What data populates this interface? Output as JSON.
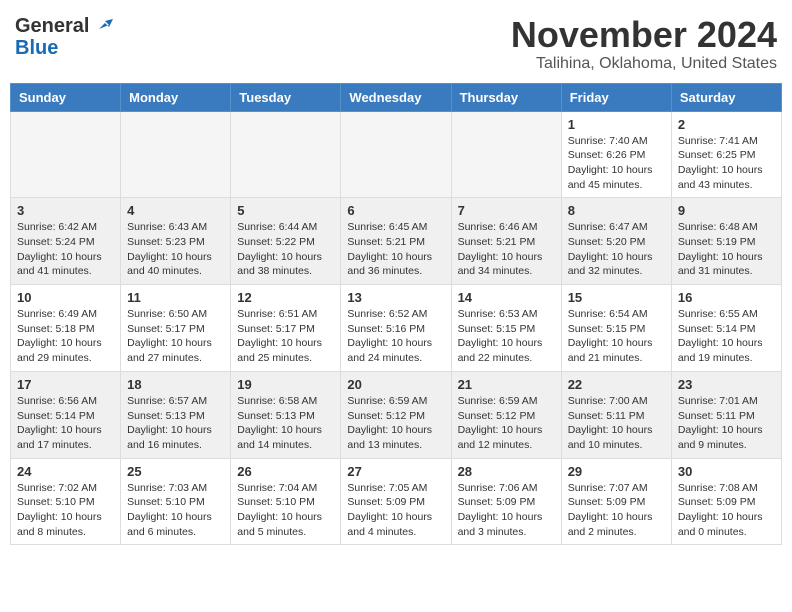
{
  "header": {
    "logo_general": "General",
    "logo_blue": "Blue",
    "month": "November 2024",
    "location": "Talihina, Oklahoma, United States"
  },
  "weekdays": [
    "Sunday",
    "Monday",
    "Tuesday",
    "Wednesday",
    "Thursday",
    "Friday",
    "Saturday"
  ],
  "weeks": [
    [
      {
        "day": "",
        "info": ""
      },
      {
        "day": "",
        "info": ""
      },
      {
        "day": "",
        "info": ""
      },
      {
        "day": "",
        "info": ""
      },
      {
        "day": "",
        "info": ""
      },
      {
        "day": "1",
        "info": "Sunrise: 7:40 AM\nSunset: 6:26 PM\nDaylight: 10 hours and 45 minutes."
      },
      {
        "day": "2",
        "info": "Sunrise: 7:41 AM\nSunset: 6:25 PM\nDaylight: 10 hours and 43 minutes."
      }
    ],
    [
      {
        "day": "3",
        "info": "Sunrise: 6:42 AM\nSunset: 5:24 PM\nDaylight: 10 hours and 41 minutes."
      },
      {
        "day": "4",
        "info": "Sunrise: 6:43 AM\nSunset: 5:23 PM\nDaylight: 10 hours and 40 minutes."
      },
      {
        "day": "5",
        "info": "Sunrise: 6:44 AM\nSunset: 5:22 PM\nDaylight: 10 hours and 38 minutes."
      },
      {
        "day": "6",
        "info": "Sunrise: 6:45 AM\nSunset: 5:21 PM\nDaylight: 10 hours and 36 minutes."
      },
      {
        "day": "7",
        "info": "Sunrise: 6:46 AM\nSunset: 5:21 PM\nDaylight: 10 hours and 34 minutes."
      },
      {
        "day": "8",
        "info": "Sunrise: 6:47 AM\nSunset: 5:20 PM\nDaylight: 10 hours and 32 minutes."
      },
      {
        "day": "9",
        "info": "Sunrise: 6:48 AM\nSunset: 5:19 PM\nDaylight: 10 hours and 31 minutes."
      }
    ],
    [
      {
        "day": "10",
        "info": "Sunrise: 6:49 AM\nSunset: 5:18 PM\nDaylight: 10 hours and 29 minutes."
      },
      {
        "day": "11",
        "info": "Sunrise: 6:50 AM\nSunset: 5:17 PM\nDaylight: 10 hours and 27 minutes."
      },
      {
        "day": "12",
        "info": "Sunrise: 6:51 AM\nSunset: 5:17 PM\nDaylight: 10 hours and 25 minutes."
      },
      {
        "day": "13",
        "info": "Sunrise: 6:52 AM\nSunset: 5:16 PM\nDaylight: 10 hours and 24 minutes."
      },
      {
        "day": "14",
        "info": "Sunrise: 6:53 AM\nSunset: 5:15 PM\nDaylight: 10 hours and 22 minutes."
      },
      {
        "day": "15",
        "info": "Sunrise: 6:54 AM\nSunset: 5:15 PM\nDaylight: 10 hours and 21 minutes."
      },
      {
        "day": "16",
        "info": "Sunrise: 6:55 AM\nSunset: 5:14 PM\nDaylight: 10 hours and 19 minutes."
      }
    ],
    [
      {
        "day": "17",
        "info": "Sunrise: 6:56 AM\nSunset: 5:14 PM\nDaylight: 10 hours and 17 minutes."
      },
      {
        "day": "18",
        "info": "Sunrise: 6:57 AM\nSunset: 5:13 PM\nDaylight: 10 hours and 16 minutes."
      },
      {
        "day": "19",
        "info": "Sunrise: 6:58 AM\nSunset: 5:13 PM\nDaylight: 10 hours and 14 minutes."
      },
      {
        "day": "20",
        "info": "Sunrise: 6:59 AM\nSunset: 5:12 PM\nDaylight: 10 hours and 13 minutes."
      },
      {
        "day": "21",
        "info": "Sunrise: 6:59 AM\nSunset: 5:12 PM\nDaylight: 10 hours and 12 minutes."
      },
      {
        "day": "22",
        "info": "Sunrise: 7:00 AM\nSunset: 5:11 PM\nDaylight: 10 hours and 10 minutes."
      },
      {
        "day": "23",
        "info": "Sunrise: 7:01 AM\nSunset: 5:11 PM\nDaylight: 10 hours and 9 minutes."
      }
    ],
    [
      {
        "day": "24",
        "info": "Sunrise: 7:02 AM\nSunset: 5:10 PM\nDaylight: 10 hours and 8 minutes."
      },
      {
        "day": "25",
        "info": "Sunrise: 7:03 AM\nSunset: 5:10 PM\nDaylight: 10 hours and 6 minutes."
      },
      {
        "day": "26",
        "info": "Sunrise: 7:04 AM\nSunset: 5:10 PM\nDaylight: 10 hours and 5 minutes."
      },
      {
        "day": "27",
        "info": "Sunrise: 7:05 AM\nSunset: 5:09 PM\nDaylight: 10 hours and 4 minutes."
      },
      {
        "day": "28",
        "info": "Sunrise: 7:06 AM\nSunset: 5:09 PM\nDaylight: 10 hours and 3 minutes."
      },
      {
        "day": "29",
        "info": "Sunrise: 7:07 AM\nSunset: 5:09 PM\nDaylight: 10 hours and 2 minutes."
      },
      {
        "day": "30",
        "info": "Sunrise: 7:08 AM\nSunset: 5:09 PM\nDaylight: 10 hours and 0 minutes."
      }
    ]
  ]
}
